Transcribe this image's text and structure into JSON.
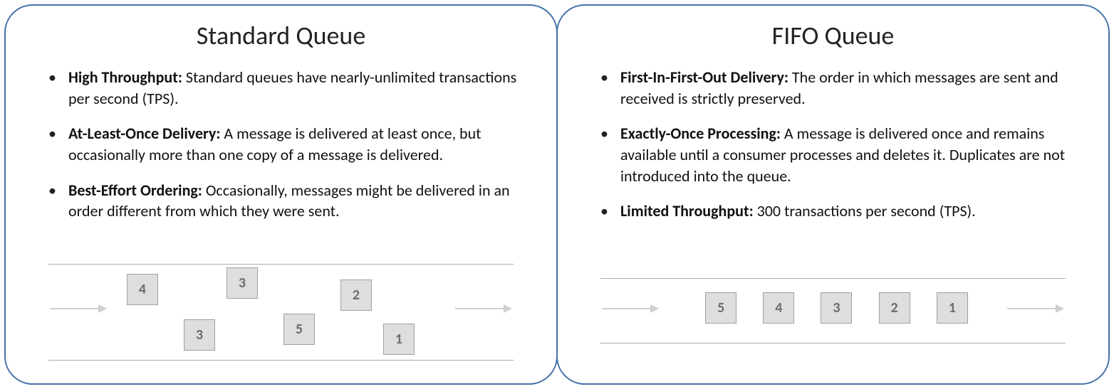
{
  "left": {
    "title": "Standard Queue",
    "bullets": [
      {
        "label": "High Throughput:",
        "text": " Standard queues have nearly-unlimited transactions per second (TPS)."
      },
      {
        "label": "At-Least-Once Delivery:",
        "text": " A message is delivered at least once, but occasionally more than one copy of a message is delivered."
      },
      {
        "label": "Best-Effort Ordering:",
        "text": " Occasionally, messages might be delivered in an order different from which they were sent."
      }
    ],
    "boxes": [
      "4",
      "3",
      "2",
      "3",
      "5",
      "1"
    ]
  },
  "right": {
    "title": "FIFO Queue",
    "bullets": [
      {
        "label": "First-In-First-Out Delivery:",
        "text": " The order in which messages are sent and received is strictly preserved."
      },
      {
        "label": "Exactly-Once Processing:",
        "text": " A message is delivered once and remains available until a consumer processes and deletes it. Duplicates are not introduced into the queue."
      },
      {
        "label": "Limited Throughput:",
        "text": " 300 transactions per second (TPS)."
      }
    ],
    "boxes": [
      "5",
      "4",
      "3",
      "2",
      "1"
    ]
  }
}
